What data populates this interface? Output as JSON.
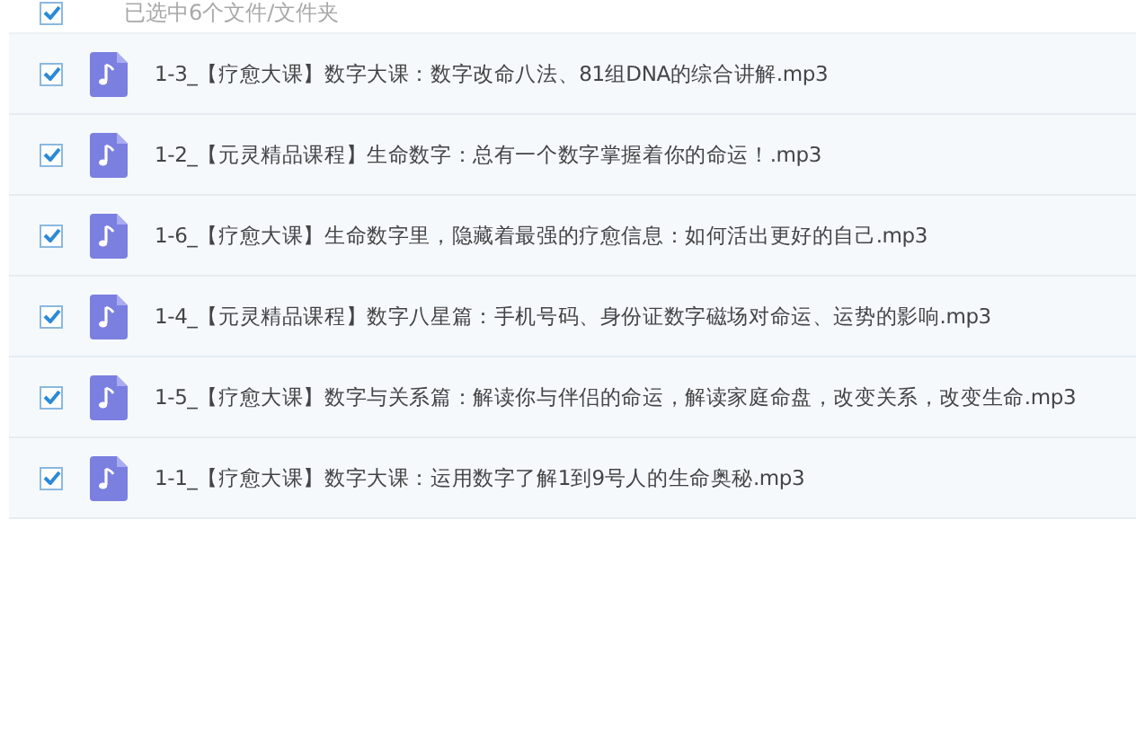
{
  "header": {
    "checked": true,
    "label": "已选中6个文件/文件夹"
  },
  "files": [
    {
      "name": "1-3_【疗愈大课】数字大课：数字改命八法、81组DNA的综合讲解.mp3",
      "checked": true
    },
    {
      "name": "1-2_【元灵精品课程】生命数字：总有一个数字掌握着你的命运！.mp3",
      "checked": true
    },
    {
      "name": "1-6_【疗愈大课】生命数字里，隐藏着最强的疗愈信息：如何活出更好的自己.mp3",
      "checked": true
    },
    {
      "name": "1-4_【元灵精品课程】数字八星篇：手机号码、身份证数字磁场对命运、运势的影响.mp3",
      "checked": true
    },
    {
      "name": "1-5_【疗愈大课】数字与关系篇：解读你与伴侣的命运，解读家庭命盘，改变关系，改变生命.mp3",
      "checked": true
    },
    {
      "name": "1-1_【疗愈大课】数字大课：运用数字了解1到9号人的生命奥秘.mp3",
      "checked": true
    }
  ]
}
